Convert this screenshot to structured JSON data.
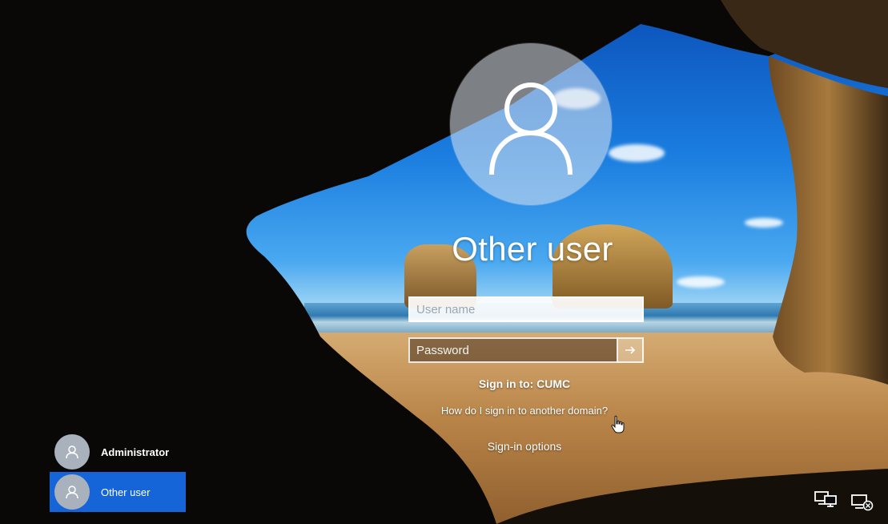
{
  "login": {
    "current_user": "Other user",
    "username_placeholder": "User name",
    "password_placeholder": "Password",
    "submit_icon": "arrow-right-icon",
    "sign_in_to": "Sign in to: CUMC",
    "domain_help_link": "How do I sign in to another domain?",
    "sign_in_options": "Sign-in options"
  },
  "user_list": [
    {
      "name": "Administrator",
      "selected": false
    },
    {
      "name": "Other user",
      "selected": true
    }
  ],
  "system_icons": [
    "network-icon",
    "accessibility-icon"
  ],
  "colors": {
    "selected_user_bg": "#1565d8",
    "text": "#ffffff"
  }
}
